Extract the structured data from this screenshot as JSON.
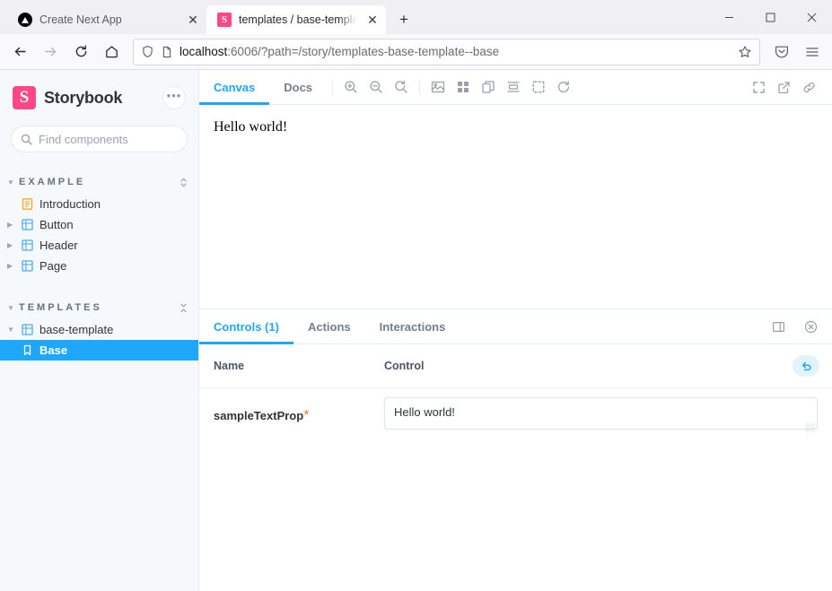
{
  "browser": {
    "tabs": [
      {
        "title": "Create Next App",
        "favicon": "nextjs-icon",
        "active": false
      },
      {
        "title": "templates / base-template - Base",
        "favicon": "storybook-icon",
        "active": true
      }
    ],
    "new_tab_label": "+",
    "window_controls": {
      "minimize": "—",
      "maximize": "□",
      "close": "✕"
    },
    "nav": {
      "back": "back-arrow-icon",
      "forward": "forward-arrow-icon",
      "reload": "reload-icon",
      "home": "home-icon"
    },
    "url": {
      "host": "localhost",
      "rest": ":6006/?path=/story/templates-base-template--base"
    },
    "url_icons": {
      "shield": "shield-icon",
      "page": "page-info-icon",
      "bookmark": "star-icon"
    },
    "toolbar_right": {
      "pocket": "pocket-icon",
      "menu": "hamburger-menu-icon"
    }
  },
  "sidebar": {
    "brand": "Storybook",
    "logo_letter": "S",
    "menu_dots": "•••",
    "search": {
      "placeholder": "Find components",
      "value": "",
      "shortcut": "/"
    },
    "groups": [
      {
        "label": "EXAMPLE",
        "action_icon": "expand-collapse-icon",
        "items": [
          {
            "label": "Introduction",
            "icon": "document-icon",
            "depth": 1,
            "has_caret": false,
            "selected": false
          },
          {
            "label": "Button",
            "icon": "component-icon",
            "depth": 1,
            "has_caret": true,
            "selected": false
          },
          {
            "label": "Header",
            "icon": "component-icon",
            "depth": 1,
            "has_caret": true,
            "selected": false
          },
          {
            "label": "Page",
            "icon": "component-icon",
            "depth": 1,
            "has_caret": true,
            "selected": false
          }
        ]
      },
      {
        "label": "TEMPLATES",
        "action_icon": "collapse-all-icon",
        "items": [
          {
            "label": "base-template",
            "icon": "component-icon",
            "depth": 1,
            "has_caret": true,
            "expanded": true,
            "selected": false
          },
          {
            "label": "Base",
            "icon": "story-bookmark-icon",
            "depth": 2,
            "has_caret": false,
            "selected": true
          }
        ]
      }
    ]
  },
  "preview": {
    "tabs": [
      {
        "label": "Canvas",
        "active": true
      },
      {
        "label": "Docs",
        "active": false
      }
    ],
    "tools": [
      "zoom-in-icon",
      "zoom-out-icon",
      "zoom-reset-icon",
      "background-icon",
      "grid-icon",
      "measure-icon",
      "ruler-icon",
      "outline-icon",
      "remount-icon"
    ],
    "tools_right": [
      "fullscreen-icon",
      "open-new-tab-icon",
      "copy-link-icon"
    ],
    "canvas_text": "Hello world!"
  },
  "panel": {
    "tabs": [
      {
        "label": "Controls (1)",
        "active": true
      },
      {
        "label": "Actions",
        "active": false
      },
      {
        "label": "Interactions",
        "active": false
      }
    ],
    "icons": [
      "panel-position-icon",
      "close-panel-icon"
    ],
    "table": {
      "headers": {
        "name": "Name",
        "control": "Control"
      },
      "reset_icon": "reset-controls-icon",
      "rows": [
        {
          "name": "sampleTextProp",
          "required": "*",
          "control_type": "textarea",
          "value": "Hello world!"
        }
      ]
    }
  },
  "colors": {
    "accent": "#1ea7fd",
    "brand_pink": "#ff4785",
    "required_orange": "#f07a2c",
    "sidebar_bg": "#f6f9fc"
  }
}
